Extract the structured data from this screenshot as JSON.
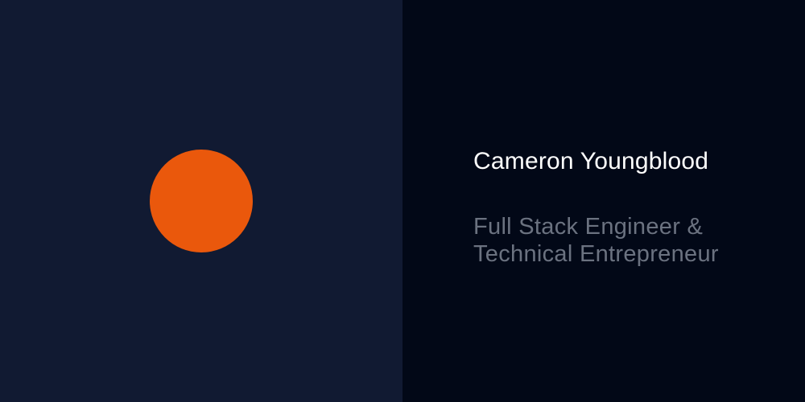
{
  "profile": {
    "name": "Cameron Youngblood",
    "tagline_line1": "Full Stack Engineer &",
    "tagline_line2": "Technical Entrepreneur"
  },
  "colors": {
    "left_background": "#111a32",
    "right_background": "#020817",
    "accent_dot": "#ea580c",
    "name_text": "#ffffff",
    "tagline_text": "#6b7280"
  }
}
